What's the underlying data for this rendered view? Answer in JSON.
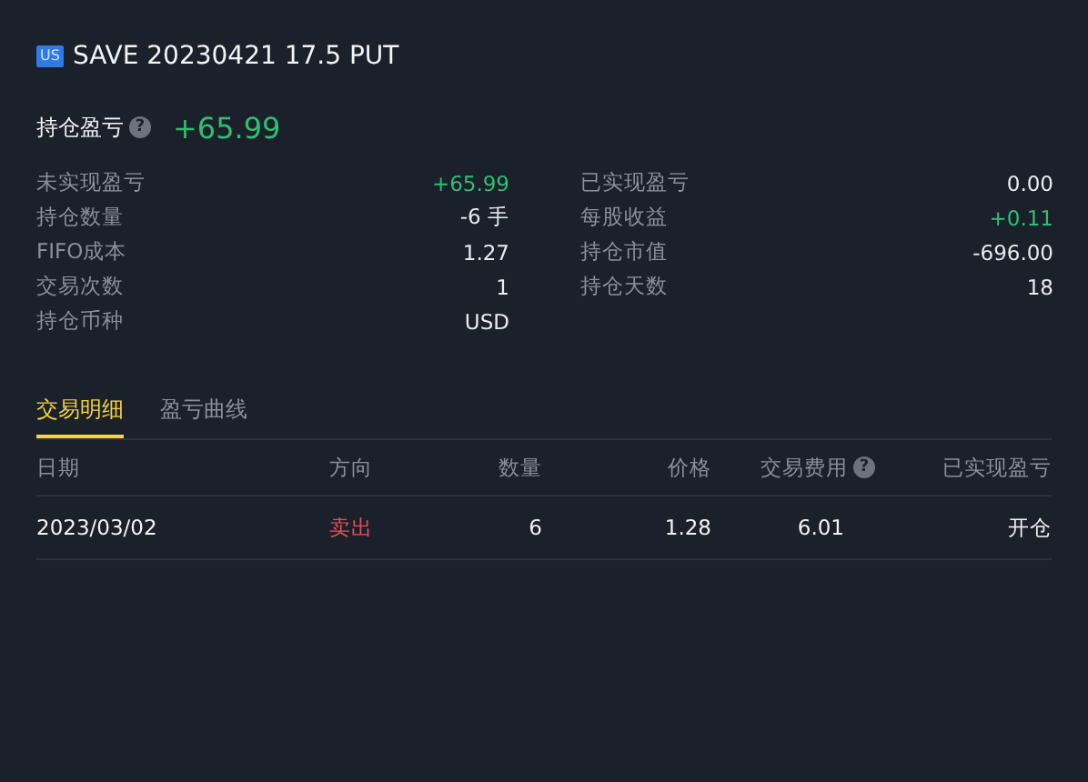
{
  "header": {
    "market_badge": "US",
    "title": "SAVE 20230421 17.5 PUT"
  },
  "position_pnl": {
    "label": "持仓盈亏",
    "help_icon": "?",
    "value": "+65.99",
    "color": "#2fbf71"
  },
  "stats_left": [
    {
      "label": "未实现盈亏",
      "value": "+65.99",
      "color": "#2fbf71"
    },
    {
      "label": "持仓数量",
      "value": "-6 手",
      "color": "#e8ebef"
    },
    {
      "label": "FIFO成本",
      "value": "1.27",
      "color": "#e8ebef"
    },
    {
      "label": "交易次数",
      "value": "1",
      "color": "#e8ebef"
    },
    {
      "label": "持仓币种",
      "value": "USD",
      "color": "#e8ebef"
    }
  ],
  "stats_right": [
    {
      "label": "已实现盈亏",
      "value": "0.00",
      "color": "#e8ebef"
    },
    {
      "label": "每股收益",
      "value": "+0.11",
      "color": "#2fbf71"
    },
    {
      "label": "持仓市值",
      "value": "-696.00",
      "color": "#e8ebef"
    },
    {
      "label": "持仓天数",
      "value": "18",
      "color": "#e8ebef"
    }
  ],
  "tabs": [
    {
      "label": "交易明细",
      "selected": true
    },
    {
      "label": "盈亏曲线",
      "selected": false
    }
  ],
  "table": {
    "columns": [
      {
        "label": "日期"
      },
      {
        "label": "方向"
      },
      {
        "label": "数量"
      },
      {
        "label": "价格"
      },
      {
        "label": "交易费用",
        "help_icon": "?"
      },
      {
        "label": "已实现盈亏"
      }
    ],
    "rows": [
      {
        "cells": [
          {
            "text": "2023/03/02"
          },
          {
            "text": "卖出",
            "color": "#ef4d55"
          },
          {
            "text": "6"
          },
          {
            "text": "1.28"
          },
          {
            "text": "6.01"
          },
          {
            "text": "开仓"
          }
        ]
      }
    ]
  }
}
